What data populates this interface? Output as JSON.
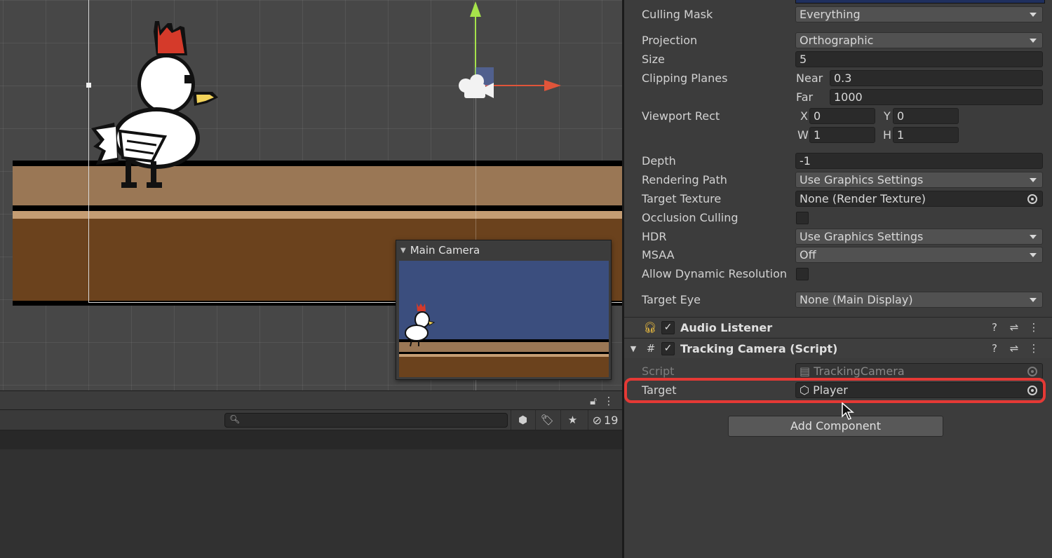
{
  "scene": {
    "preview_title": "Main Camera"
  },
  "inspector": {
    "culling_mask": {
      "label": "Culling Mask",
      "value": "Everything"
    },
    "projection": {
      "label": "Projection",
      "value": "Orthographic"
    },
    "size": {
      "label": "Size",
      "value": "5"
    },
    "clipping": {
      "label": "Clipping Planes",
      "near_label": "Near",
      "near": "0.3",
      "far_label": "Far",
      "far": "1000"
    },
    "viewport": {
      "label": "Viewport Rect",
      "x_label": "X",
      "x": "0",
      "y_label": "Y",
      "y": "0",
      "w_label": "W",
      "w": "1",
      "h_label": "H",
      "h": "1"
    },
    "depth": {
      "label": "Depth",
      "value": "-1"
    },
    "rendering_path": {
      "label": "Rendering Path",
      "value": "Use Graphics Settings"
    },
    "target_texture": {
      "label": "Target Texture",
      "value": "None (Render Texture)"
    },
    "occlusion": {
      "label": "Occlusion Culling"
    },
    "hdr": {
      "label": "HDR",
      "value": "Use Graphics Settings"
    },
    "msaa": {
      "label": "MSAA",
      "value": "Off"
    },
    "dynamic_res": {
      "label": "Allow Dynamic Resolution"
    },
    "target_eye": {
      "label": "Target Eye",
      "value": "None (Main Display)"
    },
    "audio_listener": {
      "title": "Audio Listener"
    },
    "tracking_camera": {
      "title": "Tracking Camera (Script)",
      "script_label": "Script",
      "script_value": "TrackingCamera",
      "target_label": "Target",
      "target_value": "Player"
    },
    "add_component": "Add Component"
  },
  "project": {
    "visible_count": "19"
  },
  "colors": {
    "highlight": "#e53935",
    "preview_sky": "#3b4e7e",
    "ground_top": "#9a7755",
    "ground_bottom": "#6b421d"
  }
}
